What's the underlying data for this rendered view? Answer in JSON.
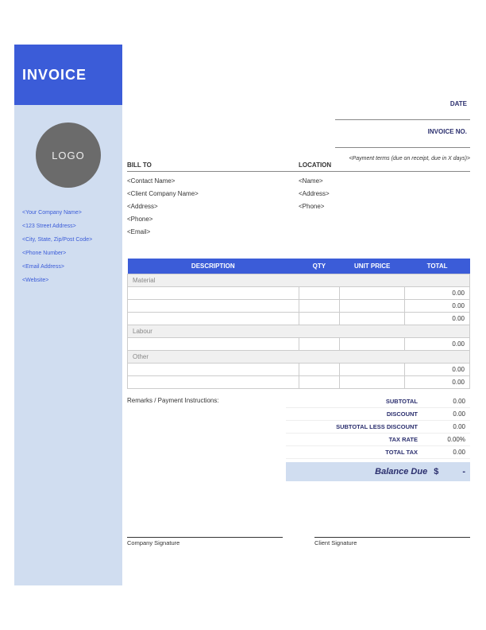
{
  "header": {
    "title": "INVOICE",
    "logo_text": "LOGO"
  },
  "company": {
    "name": "<Your Company Name>",
    "address": "<123 Street Address>",
    "city": "<City, State, Zip/Post Code>",
    "phone": "<Phone Number>",
    "email": "<Email Address>",
    "website": "<Website>"
  },
  "meta": {
    "date_label": "DATE",
    "invoice_no_label": "INVOICE NO.",
    "terms": "<Payment terms (due on receipt, due in X days)>"
  },
  "billto": {
    "label": "BILL TO",
    "contact": "<Contact Name>",
    "company": "<Client Company Name>",
    "address": "<Address>",
    "phone": "<Phone>",
    "email": "<Email>"
  },
  "location": {
    "label": "LOCATION",
    "name": "<Name>",
    "address": "<Address>",
    "phone": "<Phone>"
  },
  "table": {
    "headers": {
      "desc": "DESCRIPTION",
      "qty": "QTY",
      "price": "UNIT PRICE",
      "total": "TOTAL"
    },
    "sections": {
      "material": "Material",
      "labour": "Labour",
      "other": "Other"
    },
    "material_rows": [
      {
        "desc": "",
        "qty": "",
        "price": "",
        "total": "0.00"
      },
      {
        "desc": "",
        "qty": "",
        "price": "",
        "total": "0.00"
      },
      {
        "desc": "",
        "qty": "",
        "price": "",
        "total": "0.00"
      }
    ],
    "labour_rows": [
      {
        "desc": "",
        "qty": "",
        "price": "",
        "total": "0.00"
      }
    ],
    "other_rows": [
      {
        "desc": "",
        "qty": "",
        "price": "",
        "total": "0.00"
      },
      {
        "desc": "",
        "qty": "",
        "price": "",
        "total": "0.00"
      }
    ]
  },
  "remarks": {
    "label": "Remarks / Payment Instructions:"
  },
  "totals": {
    "subtotal_label": "SUBTOTAL",
    "subtotal": "0.00",
    "discount_label": "DISCOUNT",
    "discount": "0.00",
    "less_label": "SUBTOTAL LESS DISCOUNT",
    "less": "0.00",
    "taxrate_label": "TAX RATE",
    "taxrate": "0.00%",
    "totaltax_label": "TOTAL TAX",
    "totaltax": "0.00",
    "balance_label": "Balance Due",
    "currency": "$",
    "balance": "-"
  },
  "signatures": {
    "company": "Company Signature",
    "client": "Client Signature"
  }
}
